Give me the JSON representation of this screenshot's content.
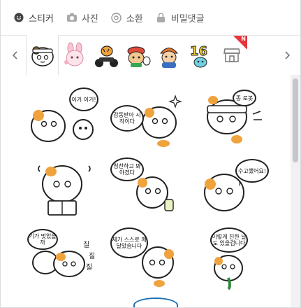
{
  "toolbar": {
    "items": [
      {
        "label": "스티커",
        "icon": "smiley-icon",
        "active": true
      },
      {
        "label": "사진",
        "icon": "camera-icon",
        "active": false
      },
      {
        "label": "소환",
        "icon": "at-icon",
        "active": false
      },
      {
        "label": "비밀댓글",
        "icon": "lock-icon",
        "active": false
      }
    ]
  },
  "tabs": {
    "prev_icon": "chevron-left-icon",
    "next_icon": "chevron-right-icon",
    "packs": [
      {
        "name": "hamster-pack",
        "selected": true
      },
      {
        "name": "pink-bunny-pack",
        "selected": false
      },
      {
        "name": "tiger-rider-pack",
        "selected": false
      },
      {
        "name": "frog-hat-pack",
        "selected": false
      },
      {
        "name": "boy-cap-pack",
        "selected": false
      },
      {
        "name": "number-16-pack",
        "selected": false
      },
      {
        "name": "sticker-store",
        "selected": false,
        "badge": "N"
      }
    ]
  },
  "stickers": [
    {
      "text": "이거 이거!"
    },
    {
      "text": "감동받아 시작이다"
    },
    {
      "text": "종 로봇"
    },
    {
      "text": ""
    },
    {
      "text": "칭찬하고 봐야겠다"
    },
    {
      "text": "수고했어요!"
    },
    {
      "text": "기가 멋있을까"
    },
    {
      "text": "제가 스스로 깨달았습니다"
    },
    {
      "text": "이렇게 친한 날도 있을겁니다"
    }
  ],
  "colors": {
    "accent": "#e8343b",
    "orange": "#f0a23c",
    "border": "#d9dbe0"
  }
}
